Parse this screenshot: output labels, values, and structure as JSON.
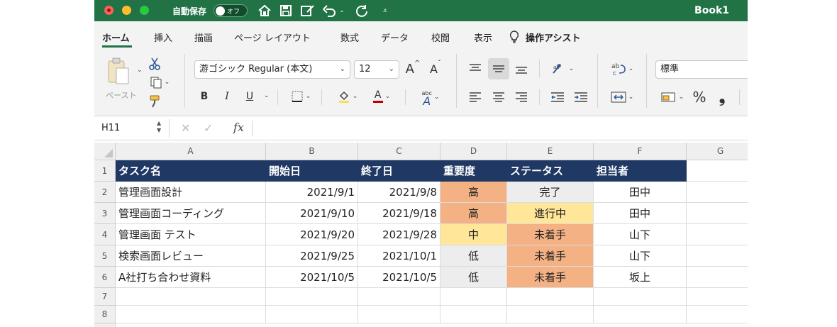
{
  "title_bar": {
    "autosave_label": "自動保存",
    "autosave_state": "オフ",
    "book_title": "Book1"
  },
  "ribbon_tabs": [
    "ホーム",
    "挿入",
    "描画",
    "ページ レイアウト",
    "数式",
    "データ",
    "校閲",
    "表示",
    "操作アシスト"
  ],
  "active_tab": "ホーム",
  "ribbon": {
    "paste_label": "ペースト",
    "font_name": "游ゴシック Regular (本文)",
    "font_size": "12",
    "number_format": "標準",
    "bold": "B",
    "italic": "I",
    "underline": "U",
    "font_color_glyph": "A",
    "grow_font": "A",
    "shrink_font": "A",
    "wrap_glyph": "abc",
    "percent": "%",
    "comma": "❟"
  },
  "formula_bar": {
    "name_box": "H11",
    "fx": "fx",
    "formula": ""
  },
  "columns": [
    "A",
    "B",
    "C",
    "D",
    "E",
    "F",
    "G"
  ],
  "rows": [
    "1",
    "2",
    "3",
    "4",
    "5",
    "6",
    "7",
    "8"
  ],
  "table": {
    "header": [
      "タスク名",
      "開始日",
      "終了日",
      "重要度",
      "ステータス",
      "担当者"
    ],
    "rows": [
      [
        "管理画面設計",
        "2021/9/1",
        "2021/9/8",
        "高",
        "完了",
        "田中"
      ],
      [
        "管理画面コーディング",
        "2021/9/10",
        "2021/9/18",
        "高",
        "進行中",
        "田中"
      ],
      [
        "管理画面 テスト",
        "2021/9/20",
        "2021/9/28",
        "中",
        "未着手",
        "山下"
      ],
      [
        "検索画面レビュー",
        "2021/9/25",
        "2021/10/1",
        "低",
        "未着手",
        "山下"
      ],
      [
        "A社打ち合わせ資料",
        "2021/10/5",
        "2021/10/5",
        "低",
        "未着手",
        "坂上"
      ]
    ]
  },
  "colors": {
    "title_bar": "#217346",
    "table_header": "#203864",
    "high": "#f4b183",
    "medium": "#ffe699",
    "low": "#ededed",
    "done": "#ededed",
    "in_progress": "#ffe699",
    "not_started": "#f4b183"
  }
}
